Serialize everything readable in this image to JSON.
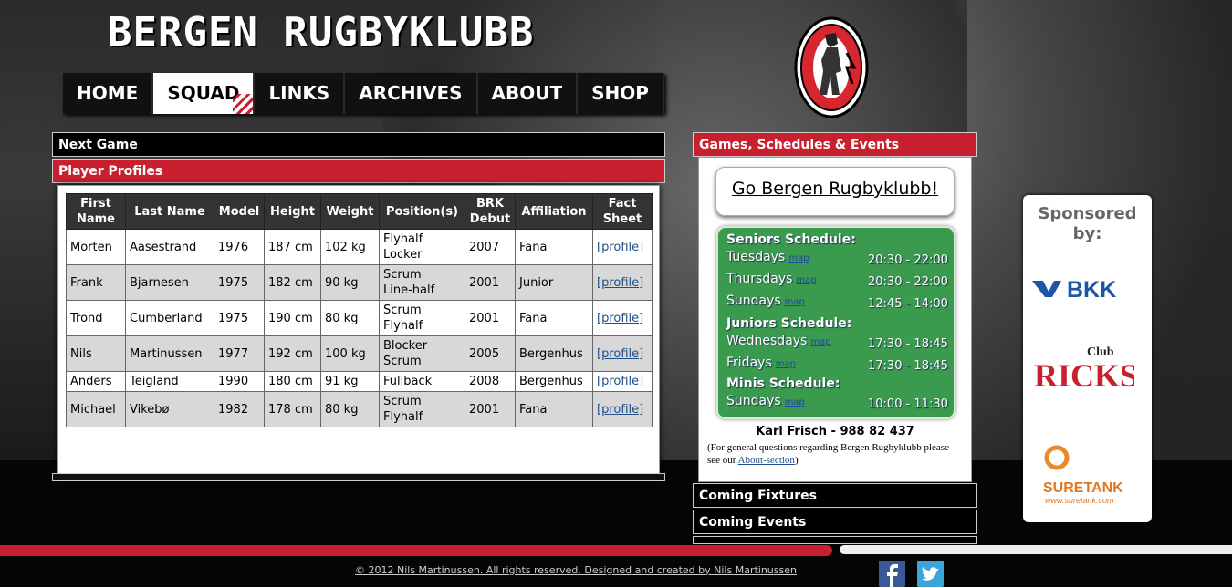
{
  "site": {
    "title": "BERGEN RUGBYKLUBB"
  },
  "nav": {
    "items": [
      "HOME",
      "SQUAD",
      "LINKS",
      "ARCHIVES",
      "ABOUT",
      "SHOP"
    ],
    "active": "SQUAD"
  },
  "left": {
    "next_game_label": "Next Game",
    "player_profiles_label": "Player Profiles",
    "table": {
      "headers": [
        "First Name",
        "Last Name",
        "Model",
        "Height",
        "Weight",
        "Position(s)",
        "BRK Debut",
        "Affiliation",
        "Fact Sheet"
      ],
      "rows": [
        [
          "Morten",
          "Aasestrand",
          "1976",
          "187 cm",
          "102 kg",
          "Flyhalf\nLocker",
          "2007",
          "Fana",
          "[profile]"
        ],
        [
          "Frank",
          "Bjarnesen",
          "1975",
          "182 cm",
          "90 kg",
          "Scrum\nLine-half",
          "2001",
          "Junior",
          "[profile]"
        ],
        [
          "Trond",
          "Cumberland",
          "1975",
          "190 cm",
          "80 kg",
          "Scrum\nFlyhalf",
          "2001",
          "Fana",
          "[profile]"
        ],
        [
          "Nils",
          "Martinussen",
          "1977",
          "192 cm",
          "100 kg",
          "Blocker\nScrum",
          "2005",
          "Bergenhus",
          "[profile]"
        ],
        [
          "Anders",
          "Teigland",
          "1990",
          "180 cm",
          "91 kg",
          "Fullback",
          "2008",
          "Bergenhus",
          "[profile]"
        ],
        [
          "Michael",
          "Vikebø",
          "1982",
          "178 cm",
          "80 kg",
          "Scrum\nFlyhalf",
          "2001",
          "Fana",
          "[profile]"
        ]
      ]
    }
  },
  "right": {
    "games_label": "Games, Schedules & Events",
    "go_text": "Go Bergen Rugbyklubb!",
    "schedule": {
      "seniors_title": "Seniors Schedule:",
      "juniors_title": "Juniors Schedule:",
      "minis_title": "Minis Schedule:",
      "map_label": "map",
      "seniors": [
        {
          "day": "Tuesdays",
          "time": "20:30 - 22:00"
        },
        {
          "day": "Thursdays",
          "time": "20:30 - 22:00"
        },
        {
          "day": "Sundays",
          "time": "12:45 - 14:00"
        }
      ],
      "juniors": [
        {
          "day": "Wednesdays",
          "time": "17:30 - 18:45"
        },
        {
          "day": "Fridays",
          "time": "17:30 - 18:45"
        }
      ],
      "minis": [
        {
          "day": "Sundays",
          "time": "10:00 - 11:30"
        }
      ]
    },
    "contact": "Karl Frisch - 988 82 437",
    "note_prefix": "(For general questions regarding Bergen Rugbyklubb please see our ",
    "note_link": "About-section",
    "note_suffix": ")",
    "coming_fixtures_label": "Coming Fixtures",
    "coming_events_label": "Coming Events"
  },
  "sponsors": {
    "title": "Sponsored by:",
    "bkk": "BKK",
    "ricks": "RICKS",
    "ricks_small": "Club",
    "suretank": "SURETANK",
    "suretank_url": "www.suretank.com"
  },
  "footer": {
    "text": "© 2012 Nils Martinussen. All rights reserved. Designed and created by Nils Martinussen"
  },
  "colors": {
    "brand_red": "#c8202f",
    "schedule_green": "#3a9a4e",
    "link_blue": "#224f87"
  }
}
